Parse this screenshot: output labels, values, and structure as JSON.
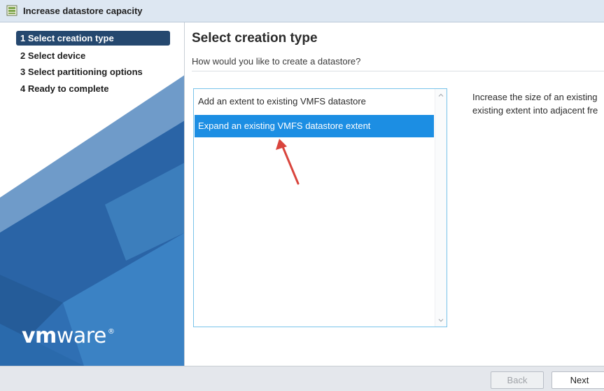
{
  "window": {
    "title": "Increase datastore capacity",
    "icon": "datastore-icon"
  },
  "sidebar": {
    "steps": [
      {
        "label": "1 Select creation type",
        "active": true
      },
      {
        "label": "2 Select device",
        "active": false
      },
      {
        "label": "3 Select partitioning options",
        "active": false
      },
      {
        "label": "4 Ready to complete",
        "active": false
      }
    ],
    "logo": {
      "bold": "vm",
      "regular": "ware",
      "mark": "®"
    }
  },
  "main": {
    "heading": "Select creation type",
    "subheading": "How would you like to create a datastore?",
    "options": [
      {
        "label": "Add an extent to existing VMFS datastore",
        "selected": false
      },
      {
        "label": "Expand an existing VMFS datastore extent",
        "selected": true
      }
    ],
    "description": {
      "line1": "Increase the size of an existing",
      "line2": "existing extent into adjacent fre"
    },
    "annotation": "red-arrow-icon"
  },
  "footer": {
    "back_label": "Back",
    "next_label": "Next"
  },
  "colors": {
    "selection": "#1c8ee3",
    "sidebar_blue": "#2c6aad",
    "active_step": "#25486f",
    "arrow": "#d9453d"
  }
}
